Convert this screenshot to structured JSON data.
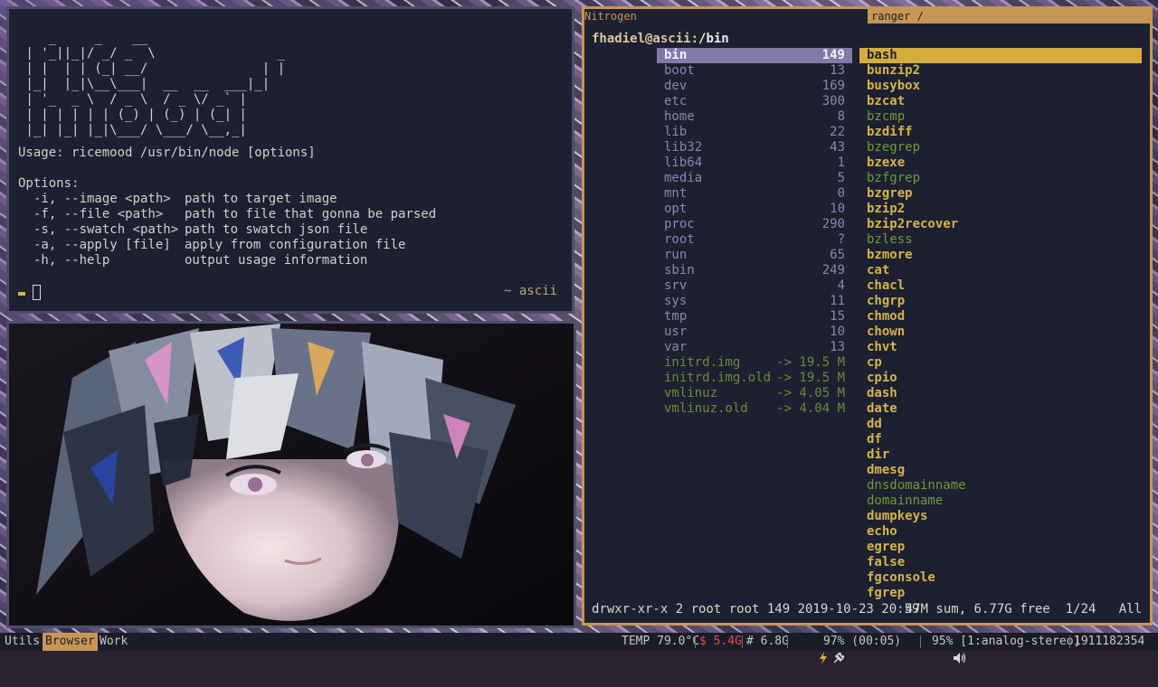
{
  "terminal": {
    "ascii_art": "    _     _    __\n | '_||_|/ _/ _  \\                _ \n | |  | | (_| __/               | |\n |_|  |_|\\__\\___|  __  __  ___|_|\n | '_  _ \\  / _ \\  / _ \\/ _` |\n | | | | | | (_) | (_) | (_| |\n |_| |_| |_|\\___/ \\___/ \\__,_|",
    "usage": "Usage: ricemood /usr/bin/node [options]",
    "options_heading": "Options:",
    "options": [
      {
        "flag": "-i, --image <path>",
        "desc": "path to target image"
      },
      {
        "flag": "-f, --file <path>",
        "desc": "path to file that gonna be parsed"
      },
      {
        "flag": "-s, --swatch <path>",
        "desc": "path to swatch json file"
      },
      {
        "flag": "-a, --apply [file]",
        "desc": "apply from configuration file"
      },
      {
        "flag": "-h, --help",
        "desc": "output usage information"
      }
    ],
    "prompt_right": "~ ascii"
  },
  "ranger": {
    "title_left": "Nitrogen",
    "title_right": "ranger /",
    "path_userhost": "fhadiel@ascii:",
    "path_dir": "/bin",
    "parent": [
      {
        "name": "bin",
        "count": "149",
        "selected": true
      },
      {
        "name": "boot",
        "count": "13"
      },
      {
        "name": "dev",
        "count": "169"
      },
      {
        "name": "etc",
        "count": "300"
      },
      {
        "name": "home",
        "count": "8"
      },
      {
        "name": "lib",
        "count": "22"
      },
      {
        "name": "lib32",
        "count": "43"
      },
      {
        "name": "lib64",
        "count": "1"
      },
      {
        "name": "media",
        "count": "5"
      },
      {
        "name": "mnt",
        "count": "0"
      },
      {
        "name": "opt",
        "count": "10"
      },
      {
        "name": "proc",
        "count": "290"
      },
      {
        "name": "root",
        "count": "?"
      },
      {
        "name": "run",
        "count": "65"
      },
      {
        "name": "sbin",
        "count": "249"
      },
      {
        "name": "srv",
        "count": "4"
      },
      {
        "name": "sys",
        "count": "11"
      },
      {
        "name": "tmp",
        "count": "15"
      },
      {
        "name": "usr",
        "count": "10"
      },
      {
        "name": "var",
        "count": "13"
      },
      {
        "name": "initrd.img",
        "count": "-> 19.5 M",
        "link": true
      },
      {
        "name": "initrd.img.old",
        "count": "-> 19.5 M",
        "link": true
      },
      {
        "name": "vmlinuz",
        "count": "-> 4.05 M",
        "link": true
      },
      {
        "name": "vmlinuz.old",
        "count": "-> 4.04 M",
        "link": true
      }
    ],
    "children": [
      {
        "name": "bash",
        "selected": true
      },
      {
        "name": "bunzip2"
      },
      {
        "name": "busybox"
      },
      {
        "name": "bzcat"
      },
      {
        "name": "bzcmp",
        "link": true
      },
      {
        "name": "bzdiff"
      },
      {
        "name": "bzegrep",
        "link": true
      },
      {
        "name": "bzexe"
      },
      {
        "name": "bzfgrep",
        "link": true
      },
      {
        "name": "bzgrep"
      },
      {
        "name": "bzip2"
      },
      {
        "name": "bzip2recover"
      },
      {
        "name": "bzless",
        "link": true
      },
      {
        "name": "bzmore"
      },
      {
        "name": "cat"
      },
      {
        "name": "chacl"
      },
      {
        "name": "chgrp"
      },
      {
        "name": "chmod"
      },
      {
        "name": "chown"
      },
      {
        "name": "chvt"
      },
      {
        "name": "cp"
      },
      {
        "name": "cpio"
      },
      {
        "name": "dash"
      },
      {
        "name": "date"
      },
      {
        "name": "dd"
      },
      {
        "name": "df"
      },
      {
        "name": "dir"
      },
      {
        "name": "dmesg"
      },
      {
        "name": "dnsdomainname",
        "link": true
      },
      {
        "name": "domainname",
        "link": true
      },
      {
        "name": "dumpkeys"
      },
      {
        "name": "echo"
      },
      {
        "name": "egrep"
      },
      {
        "name": "false"
      },
      {
        "name": "fgconsole"
      },
      {
        "name": "fgrep"
      }
    ],
    "status_left": "drwxr-xr-x 2 root root 149 2019-10-23 20:59",
    "status_right": "47M sum, 6.77G free  1/24   All"
  },
  "bar": {
    "workspaces": [
      "Utils",
      "Browser",
      "Work"
    ],
    "active_workspace": 1,
    "temp": "TEMP 79.0°C",
    "mem": "$ 5.4G",
    "disk": "# 6.8G",
    "battery": "97% (00:05)",
    "volume": "95% [1:analog-stereo]",
    "clock": "1911182354"
  },
  "colors": {
    "accent": "#c69654",
    "terminal_bg": "#1d2030",
    "selection_parent": "#7f7aa7",
    "selection_child": "#d6ac3e",
    "exec_yellow": "#d4b44c",
    "link_green": "#6f9a3c",
    "mem_red": "#e05050"
  },
  "icons": [
    "battery-bolt-icon",
    "plug-icon",
    "speaker-icon"
  ]
}
